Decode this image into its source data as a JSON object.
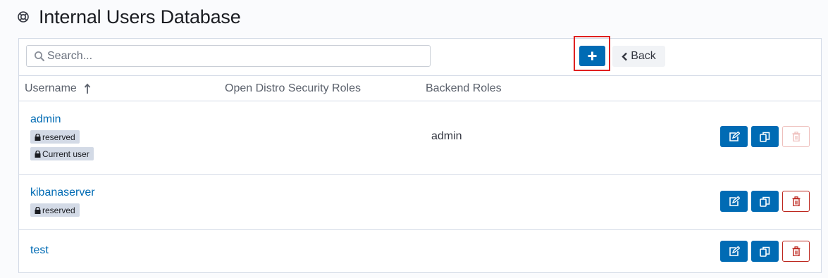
{
  "page": {
    "title": "Internal Users Database",
    "title_icon": "life-ring-icon"
  },
  "toolbar": {
    "search_placeholder": "Search...",
    "search_value": "",
    "add_icon": "plus-icon",
    "back_label": "Back"
  },
  "table": {
    "headers": {
      "username": "Username",
      "roles": "Open Distro Security Roles",
      "backend": "Backend Roles"
    },
    "sort": {
      "column": "username",
      "direction": "ascending"
    },
    "rows": [
      {
        "username": "admin",
        "badges": [
          "reserved",
          "Current user"
        ],
        "roles": "",
        "backend_roles": "admin",
        "delete_enabled": false
      },
      {
        "username": "kibanaserver",
        "badges": [
          "reserved"
        ],
        "roles": "",
        "backend_roles": "",
        "delete_enabled": true
      },
      {
        "username": "test",
        "badges": [],
        "roles": "",
        "backend_roles": "",
        "delete_enabled": true
      }
    ]
  },
  "colors": {
    "primary": "#006bb4",
    "danger": "#bd271e",
    "highlight": "#e02020",
    "badge_bg": "#d3dae6"
  }
}
